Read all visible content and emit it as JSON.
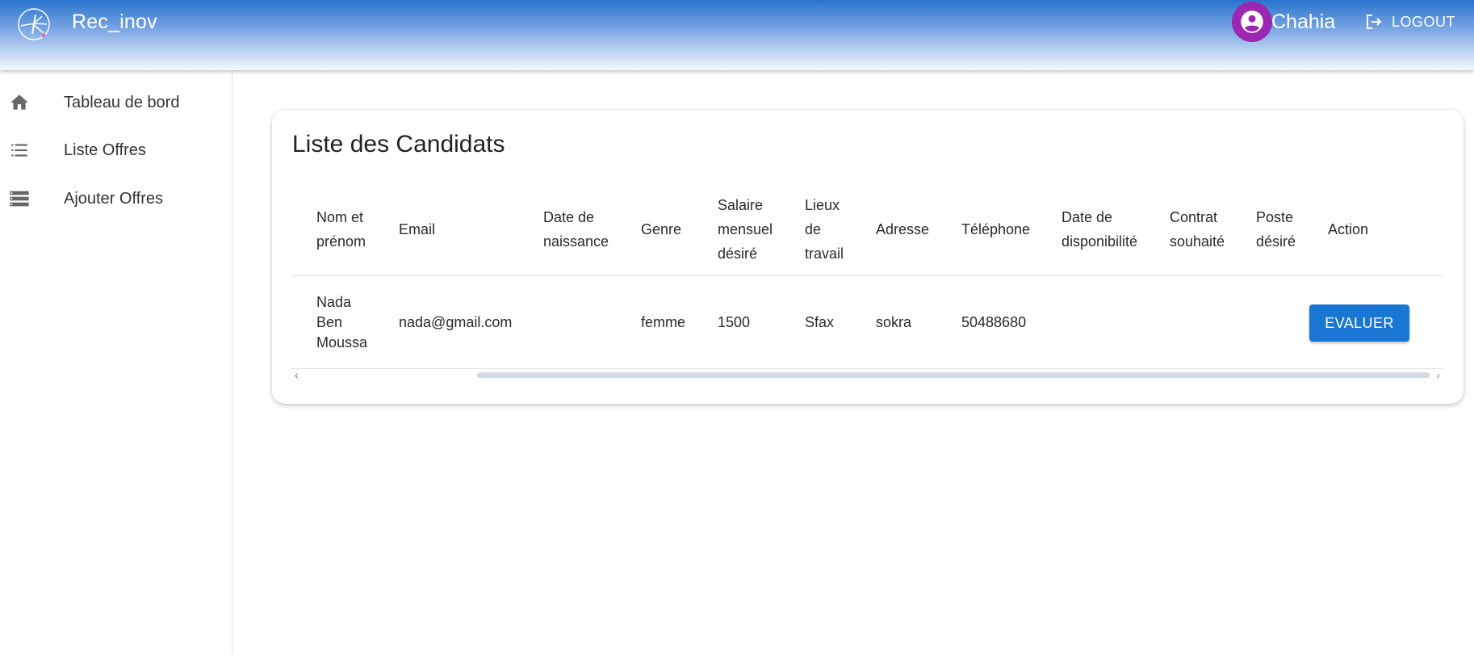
{
  "app": {
    "title": "Rec_inov"
  },
  "user": {
    "name": "Chahia"
  },
  "header": {
    "logout_label": "LOGOUT"
  },
  "sidebar": {
    "items": [
      {
        "label": "Tableau de bord",
        "icon": "home-icon"
      },
      {
        "label": "Liste Offres",
        "icon": "list-icon"
      },
      {
        "label": "Ajouter Offres",
        "icon": "storage-icon"
      }
    ]
  },
  "main": {
    "title": "Liste des Candidats",
    "columns": [
      [
        "Nom et",
        "prénom"
      ],
      [
        "Email"
      ],
      [
        "Date de",
        "naissance"
      ],
      [
        "Genre"
      ],
      [
        "Salaire",
        "mensuel",
        "désiré"
      ],
      [
        "Lieux",
        "de",
        "travail"
      ],
      [
        "Adresse"
      ],
      [
        "Téléphone"
      ],
      [
        "Date de",
        "disponibilité"
      ],
      [
        "Contrat",
        "souhaité"
      ],
      [
        "Poste",
        "désiré"
      ],
      [
        "Action"
      ]
    ],
    "rows": [
      {
        "name": [
          "Nada",
          "Ben",
          "Moussa"
        ],
        "email": "nada@gmail.com",
        "birth_date": "",
        "gender": "femme",
        "salary": "1500",
        "work_place": "Sfax",
        "address": "sokra",
        "phone": "50488680",
        "availability": "",
        "contract": "",
        "position": "",
        "action_label": "EVALUER"
      }
    ]
  },
  "colors": {
    "primary": "#1976d2",
    "avatar": "#9c27b0",
    "header_top": "#2a74cc"
  }
}
